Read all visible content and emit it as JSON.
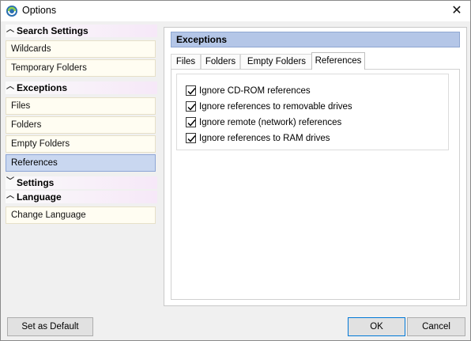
{
  "window": {
    "title": "Options",
    "close_icon": "close-icon",
    "app_icon": "app-icon"
  },
  "sidebar": {
    "groups": [
      {
        "label": "Search Settings",
        "expanded": true,
        "items": [
          {
            "label": "Wildcards"
          },
          {
            "label": "Temporary Folders"
          }
        ]
      },
      {
        "label": "Exceptions",
        "expanded": true,
        "items": [
          {
            "label": "Files"
          },
          {
            "label": "Folders"
          },
          {
            "label": "Empty Folders"
          },
          {
            "label": "References",
            "selected": true
          }
        ]
      },
      {
        "label": "Settings",
        "expanded": false,
        "items": []
      },
      {
        "label": "Language",
        "expanded": true,
        "items": [
          {
            "label": "Change Language"
          }
        ]
      }
    ]
  },
  "main": {
    "section_title": "Exceptions",
    "tabs": [
      {
        "label": "Files"
      },
      {
        "label": "Folders"
      },
      {
        "label": "Empty Folders"
      },
      {
        "label": "References",
        "active": true
      }
    ],
    "references": {
      "options": [
        {
          "label": "Ignore CD-ROM references",
          "checked": true
        },
        {
          "label": "Ignore references to removable drives",
          "checked": true
        },
        {
          "label": "Ignore remote (network) references",
          "checked": true
        },
        {
          "label": "Ignore references to RAM drives",
          "checked": true
        }
      ]
    }
  },
  "footer": {
    "set_default_label": "Set as Default",
    "ok_label": "OK",
    "cancel_label": "Cancel"
  },
  "colors": {
    "section_header": "#b4c6e7",
    "selected_item": "#c9d7f0",
    "nav_item_bg": "#fffdf2",
    "default_button_border": "#0078d7"
  }
}
